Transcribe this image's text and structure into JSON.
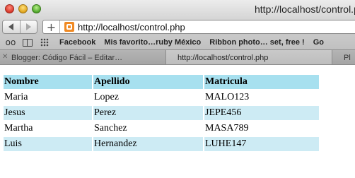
{
  "window": {
    "title": "http://localhost/control.php"
  },
  "toolbar": {
    "back_icon": "back-arrow-icon",
    "forward_icon": "forward-arrow-icon",
    "add_icon": "plus-icon",
    "url": "http://localhost/control.php"
  },
  "bookmarks": {
    "items": [
      {
        "label": "Facebook"
      },
      {
        "label": "Mis favorito…ruby México"
      },
      {
        "label": "Ribbon photo… set, free !"
      },
      {
        "label": "Go"
      }
    ]
  },
  "tabs": [
    {
      "label": "Blogger: Código Fácil – Editar…"
    },
    {
      "label": "http://localhost/control.php"
    },
    {
      "label": "Pl"
    }
  ],
  "table": {
    "headers": [
      "Nombre",
      "Apellido",
      "Matricula"
    ],
    "rows": [
      [
        "Maria",
        "Lopez",
        "MALO123"
      ],
      [
        "Jesus",
        "Perez",
        "JEPE456"
      ],
      [
        "Martha",
        "Sanchez",
        "MASA789"
      ],
      [
        "Luis",
        "Hernandez",
        "LUHE147"
      ]
    ]
  },
  "colors": {
    "header_bg": "#a7e0ef",
    "alt_row_bg": "#cdebf4"
  }
}
